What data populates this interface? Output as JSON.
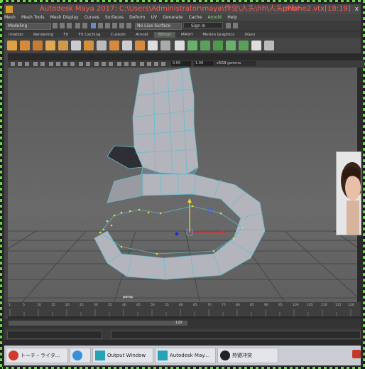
{
  "title": {
    "app": "Autodesk Maya 2017: C:\\Users\\Administrator\\maya\\作业\\人头\\hh\\人头.mb*",
    "right": "pPlane2.vtx[18:19]",
    "close": "x"
  },
  "menubar": [
    "Mesh",
    "Mesh Tools",
    "Mesh Display",
    "Curves",
    "Surfaces",
    "Deform",
    "UV",
    "Generate",
    "Cache",
    "Arnold",
    "Help"
  ],
  "statusline": {
    "modeling": "Modeling",
    "live_surface": "No Live Surface",
    "sign_in": "Sign In"
  },
  "shelf_tabs": [
    {
      "label": "imation",
      "active": false
    },
    {
      "label": "Rendering",
      "active": false
    },
    {
      "label": "FX",
      "active": false
    },
    {
      "label": "FX Caching",
      "active": false
    },
    {
      "label": "Custom",
      "active": false
    },
    {
      "label": "Arnold",
      "active": false
    },
    {
      "label": "Bifrost",
      "active": true
    },
    {
      "label": "MASH",
      "active": false
    },
    {
      "label": "Motion Graphics",
      "active": false
    },
    {
      "label": "XGen",
      "active": false
    }
  ],
  "viewport_toolbar": {
    "near": "0.00",
    "far": "1.00",
    "color_space": "sRGB gamma"
  },
  "viewport": {
    "camera": "persp"
  },
  "timeline": {
    "ticks": [
      "1",
      "5",
      "10",
      "15",
      "20",
      "25",
      "30",
      "35",
      "40",
      "45",
      "50",
      "55",
      "60",
      "65",
      "70",
      "75",
      "80",
      "85",
      "90",
      "95",
      "100",
      "105",
      "110",
      "115",
      "120"
    ]
  },
  "range": {
    "value": "120"
  },
  "taskbar": [
    {
      "label": "トーチ・ライタ...",
      "icon_color": "#d23a2a"
    },
    {
      "label": "",
      "icon_color": "#3a8fd6"
    },
    {
      "label": "Output Window",
      "icon_color": "#27a3b8"
    },
    {
      "label": "Autodesk May...",
      "icon_color": "#27a3b8"
    },
    {
      "label": "热键冲突",
      "icon_color": "#222222"
    }
  ],
  "colors": {
    "accent_green": "#6cd84a",
    "title_text": "#ff5a5a",
    "mesh_face": "#b4b4bc",
    "mesh_edge": "#62c0d0",
    "selection_vertex": "#f0e020"
  }
}
